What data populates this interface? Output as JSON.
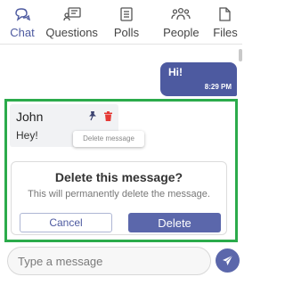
{
  "tabs": [
    {
      "label": "Chat",
      "icon": "chat-icon",
      "active": true
    },
    {
      "label": "Questions",
      "icon": "questions-icon",
      "active": false
    },
    {
      "label": "Polls",
      "icon": "polls-icon",
      "active": false
    },
    {
      "label": "People",
      "icon": "people-icon",
      "active": false
    },
    {
      "label": "Files",
      "icon": "files-icon",
      "active": false
    }
  ],
  "outgoing_message": {
    "text": "Hi!",
    "time": "8:29 PM"
  },
  "incoming_message": {
    "sender": "John",
    "text": "Hey!",
    "actions": [
      "pin-icon",
      "trash-icon"
    ],
    "tooltip": "Delete message"
  },
  "delete_dialog": {
    "title": "Delete this message?",
    "message": "This will permanently delete the message.",
    "cancel_label": "Cancel",
    "delete_label": "Delete"
  },
  "composer": {
    "placeholder": "Type a message",
    "send_icon": "send-icon"
  },
  "colors": {
    "accent": "#4d5aa0",
    "button": "#5b67ab",
    "highlight": "#2bab4b",
    "danger": "#e53935"
  }
}
